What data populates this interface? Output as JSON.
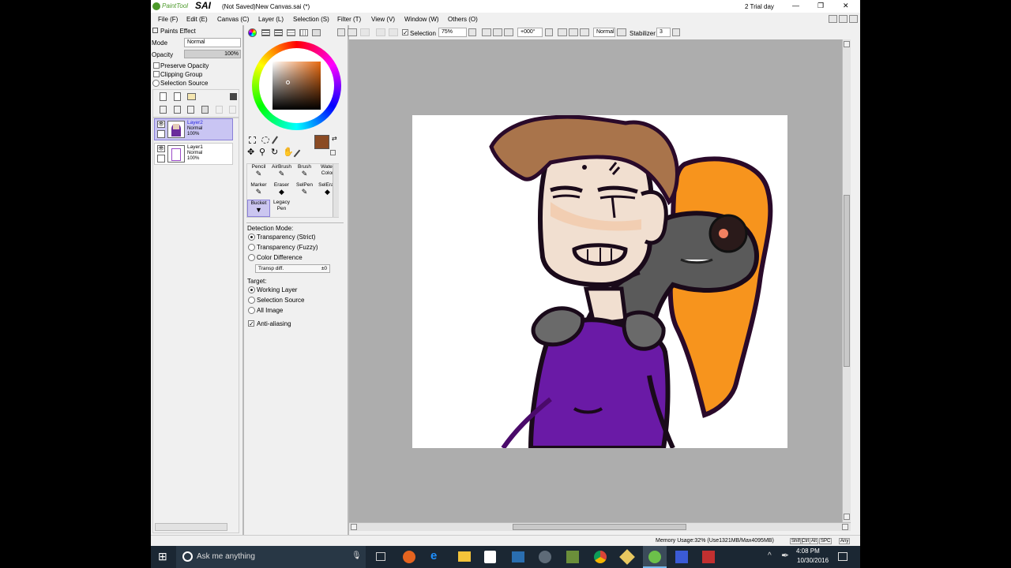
{
  "window": {
    "app_logo_text": "PaintTool",
    "app_logo_brand": "SAI",
    "title": "(Not Saved)New Canvas.sai (*)",
    "trial": "2 Trial day",
    "minimize_glyph": "—",
    "restore_glyph": "❐",
    "close_glyph": "✕"
  },
  "menu": [
    "File (F)",
    "Edit (E)",
    "Canvas (C)",
    "Layer (L)",
    "Selection (S)",
    "Filter (T)",
    "View (V)",
    "Window (W)",
    "Others (O)"
  ],
  "layer_panel": {
    "paints_effect": "Paints Effect",
    "mode_label": "Mode",
    "mode_value": "Normal",
    "opacity_label": "Opacity",
    "opacity_value": "100%",
    "opacity_fraction": 1.0,
    "preserve_opacity": "Preserve Opacity",
    "clipping_group": "Clipping Group",
    "selection_source": "Selection Source",
    "layers": [
      {
        "name": "Layer2",
        "mode": "Normal",
        "opacity": "100%",
        "selected": true
      },
      {
        "name": "Layer1",
        "mode": "Normal",
        "opacity": "100%",
        "selected": false
      }
    ]
  },
  "toolbar": {
    "selection_label": "Selection",
    "zoom": "75%",
    "rotation": "+000°",
    "blend": "Normal",
    "stabilizer_label": "Stabilizer",
    "stabilizer_value": "3"
  },
  "tools": [
    {
      "label": "Pencil",
      "selected": false
    },
    {
      "label": "AirBrush",
      "selected": false
    },
    {
      "label": "Brush",
      "selected": false
    },
    {
      "label": "Water Color",
      "selected": false
    },
    {
      "label": "Marker",
      "selected": false
    },
    {
      "label": "Eraser",
      "selected": false
    },
    {
      "label": "SelPen",
      "selected": false
    },
    {
      "label": "SelEras",
      "selected": false
    },
    {
      "label": "Bucket",
      "selected": true
    },
    {
      "label": "Legacy Pen",
      "selected": false
    }
  ],
  "bucket_options": {
    "detection_mode_label": "Detection Mode:",
    "modes": [
      {
        "label": "Transparency (Strict)",
        "checked": true
      },
      {
        "label": "Transparency (Fuzzy)",
        "checked": false
      },
      {
        "label": "Color Difference",
        "checked": false
      }
    ],
    "transp_diff_label": "Transp diff.",
    "transp_diff_value": "±0",
    "target_label": "Target:",
    "targets": [
      {
        "label": "Working Layer",
        "checked": true
      },
      {
        "label": "Selection Source",
        "checked": false
      },
      {
        "label": "All Image",
        "checked": false
      }
    ],
    "antialiasing": "Anti-aliasing"
  },
  "colors": {
    "primary": "#8a4b24",
    "window_bg": "#f0f0f0",
    "canvas_area": "#adadad",
    "selection": "#cbc6f0"
  },
  "status": {
    "memory": "Memory Usage:32% (Use1321MB/Max4095MB)",
    "keys": [
      "Shift",
      "Ctrl",
      "Alt",
      "SPC",
      "Any"
    ]
  },
  "taskbar": {
    "search_placeholder": "Ask me anything",
    "time": "4:08 PM",
    "date": "10/30/2016"
  }
}
